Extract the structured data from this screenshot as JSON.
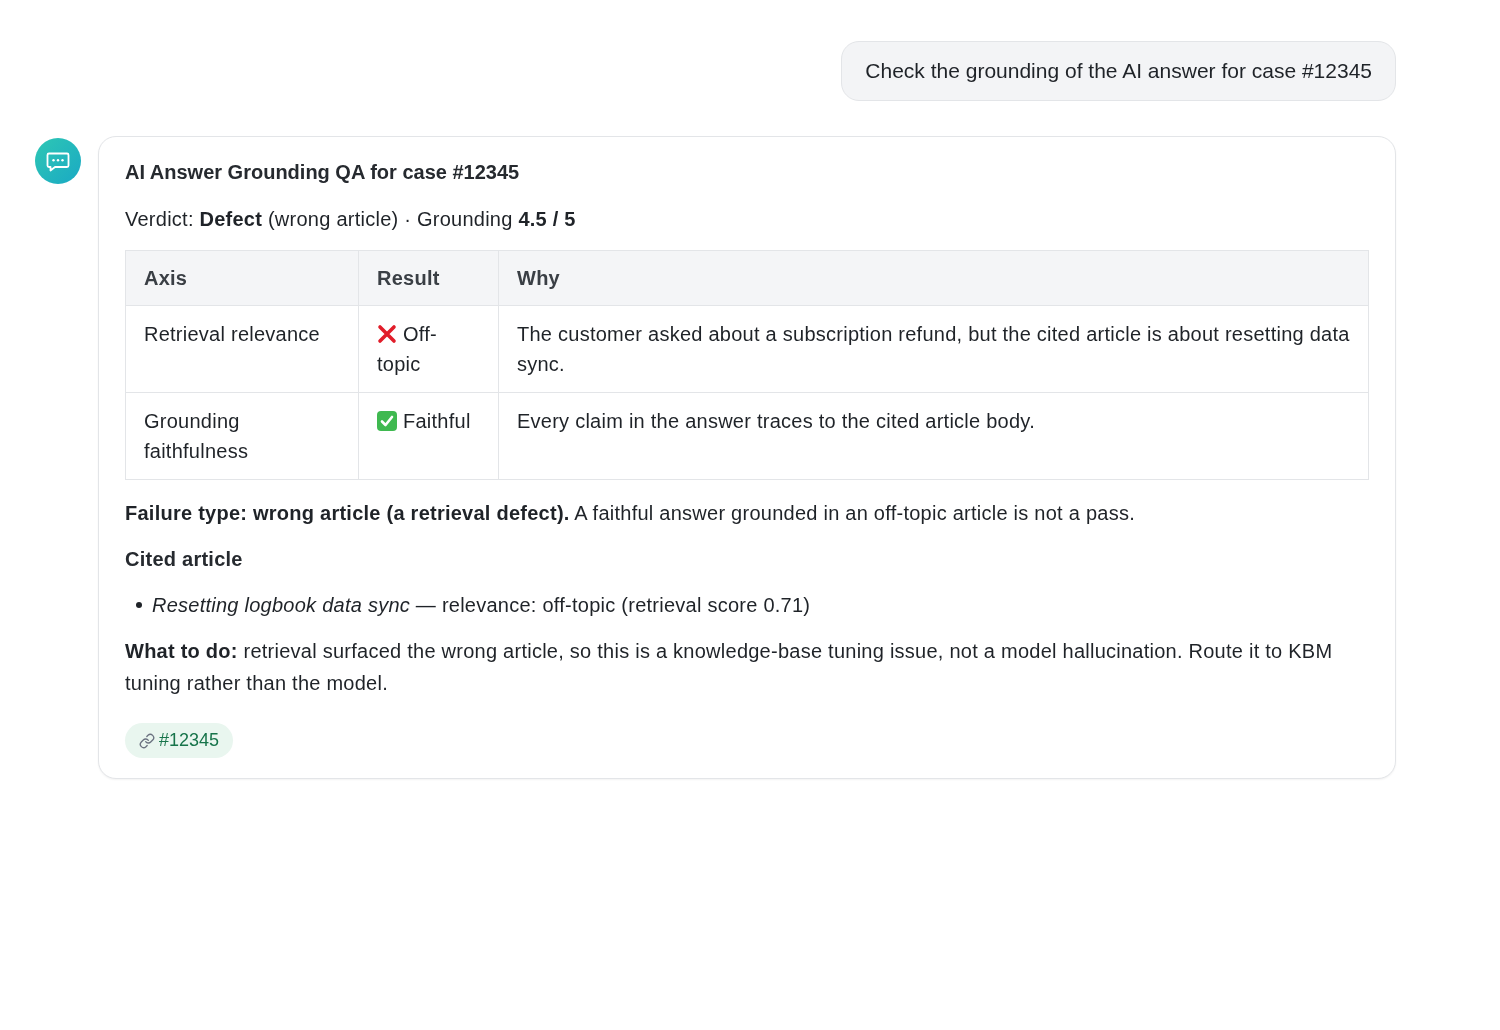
{
  "user_message": {
    "text": "Check the grounding of the AI answer for case #12345"
  },
  "assistant_message": {
    "title": "AI Answer Grounding QA for case #12345",
    "verdict": "Verdict: **Defect** (wrong article) · Grounding **4.5 / 5**",
    "table": {
      "columns": [
        "Axis",
        "Result",
        "Why"
      ],
      "rows": [
        {
          "axis": "Retrieval relevance",
          "result": {
            "kind": "fail",
            "text": "Off-topic"
          },
          "why": "The customer asked about a subscription refund, but the cited article is about resetting data sync."
        },
        {
          "axis": "Grounding faithfulness",
          "result": {
            "kind": "pass",
            "text": "Faithful"
          },
          "why": "Every claim in the answer traces to the cited article body."
        }
      ]
    },
    "failure_note": "**Failure type: wrong article (a retrieval defect).** A faithful answer grounded in an off-topic article is not a pass.",
    "cited_heading": "Cited article",
    "cited_items": [
      "*Resetting logbook data sync* — relevance: off-topic (retrieval score 0.71)"
    ],
    "action_note": "**What to do:** retrieval surfaced the wrong article, so this is a knowledge-base tuning issue, not a model hallucination. Route it to KBM tuning rather than the model.",
    "tags": [
      {
        "label": "#12345"
      }
    ]
  }
}
